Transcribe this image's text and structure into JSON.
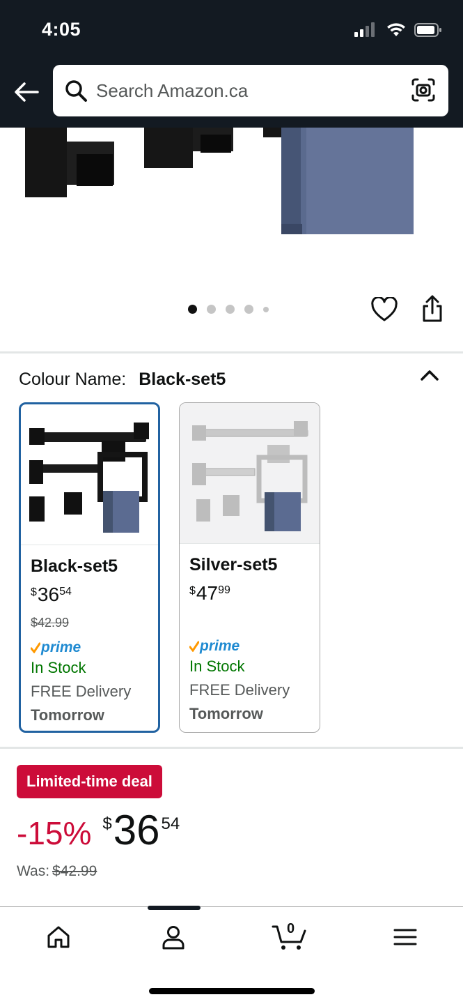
{
  "status_bar": {
    "time": "4:05"
  },
  "search": {
    "placeholder": "Search Amazon.ca"
  },
  "carousel": {
    "total_dots": 5,
    "active_index": 0
  },
  "colour": {
    "label": "Colour Name:",
    "selected_value": "Black-set5",
    "options": [
      {
        "name": "Black-set5",
        "price_symbol": "$",
        "price_whole": "36",
        "price_cents": "54",
        "was_price": "$42.99",
        "prime": "prime",
        "stock": "In Stock",
        "delivery": "FREE Delivery",
        "delivery_day": "Tomorrow",
        "selected": true
      },
      {
        "name": "Silver-set5",
        "price_symbol": "$",
        "price_whole": "47",
        "price_cents": "99",
        "was_price": "",
        "prime": "prime",
        "stock": "In Stock",
        "delivery": "FREE Delivery",
        "delivery_day": "Tomorrow",
        "selected": false
      }
    ]
  },
  "deal": {
    "badge": "Limited-time deal",
    "discount": "-15%",
    "price_symbol": "$",
    "price_whole": "36",
    "price_cents": "54",
    "was_label": "Was:",
    "was_price": "$42.99"
  },
  "bottom_nav": {
    "cart_count": "0"
  },
  "colors": {
    "header_bg": "#131a22",
    "selected_border": "#2162a1",
    "deal_red": "#cc0c39",
    "in_stock_green": "#007600",
    "prime_blue": "#1f8ad1"
  }
}
